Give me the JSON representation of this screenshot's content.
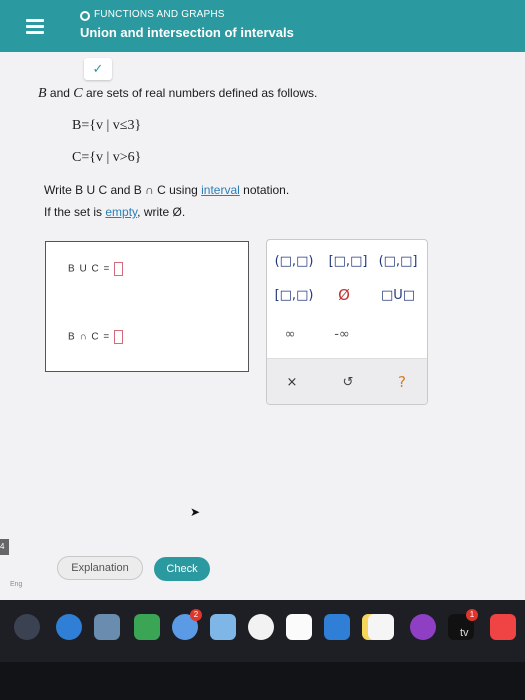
{
  "header": {
    "topic": "FUNCTIONS AND GRAPHS",
    "title": "Union and intersection of intervals"
  },
  "question": {
    "intro_pre": "B",
    "intro_and": " and ",
    "intro_c": "C",
    "intro_post": " are sets of real numbers defined as follows.",
    "set_b": "B={v | v≤3}",
    "set_c": "C={v | v>6}",
    "instruction_pre": "Write B U C and B ∩ C using ",
    "instruction_link": "interval",
    "instruction_post": " notation.",
    "empty_pre": "If the set is ",
    "empty_link": "empty",
    "empty_post": ", write Ø."
  },
  "answers": {
    "union_label": "B U C =",
    "intersection_label": "B ∩ C ="
  },
  "keypad": {
    "open_open": "(□,□)",
    "closed_closed": "[□,□]",
    "open_closed": "(□,□]",
    "closed_open": "[□,□)",
    "empty_set": "Ø",
    "union": "□U□",
    "infinity": "∞",
    "neg_infinity": "-∞",
    "clear": "×",
    "undo": "↺",
    "help": "?"
  },
  "footer": {
    "side_tab": "4",
    "explanation": "Explanation",
    "check": "Check",
    "language": "Eng"
  },
  "dock": {
    "apps": [
      "launchpad",
      "safari",
      "mail",
      "messages",
      "maps",
      "photos",
      "notes",
      "reminders",
      "itunes",
      "podcasts",
      "appletv",
      "news"
    ],
    "tv_label": "tv",
    "badges": {
      "messages": "2",
      "appletv": "1"
    }
  }
}
